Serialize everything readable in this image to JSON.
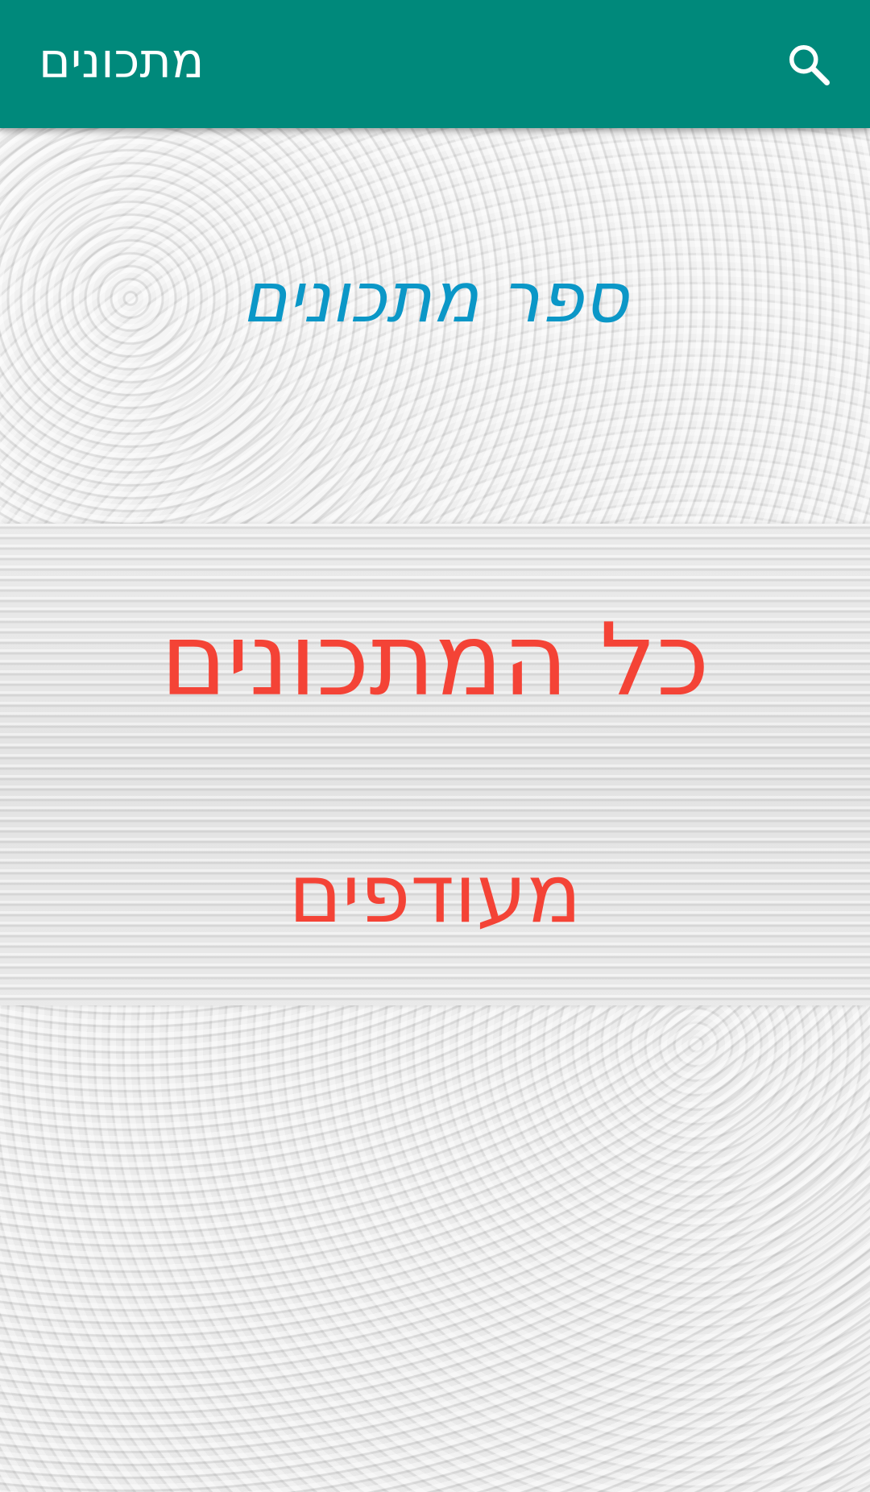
{
  "app_bar": {
    "title": "מתכונים",
    "search_icon": "search-icon",
    "background": "#00897b"
  },
  "main": {
    "book_title": "ספר מתכונים",
    "book_title_color": "#0b97c7",
    "menu": {
      "all_recipes": "כל המתכונים",
      "favorites": "מעודפים",
      "item_color": "#f44336"
    }
  }
}
